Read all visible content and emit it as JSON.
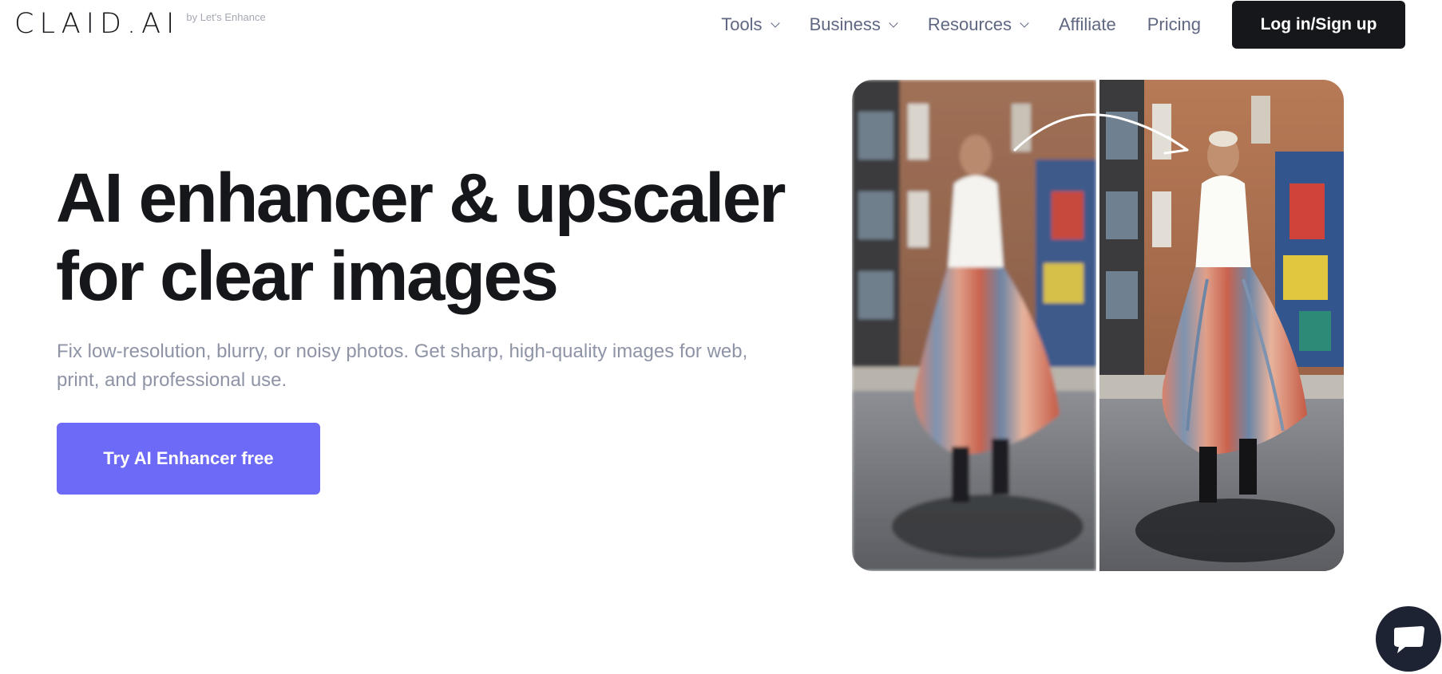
{
  "header": {
    "logo_text": "CLAID.AI",
    "logo_sub": "by Let's Enhance",
    "nav": [
      {
        "label": "Tools",
        "has_dropdown": true
      },
      {
        "label": "Business",
        "has_dropdown": true
      },
      {
        "label": "Resources",
        "has_dropdown": true
      },
      {
        "label": "Affiliate",
        "has_dropdown": false
      },
      {
        "label": "Pricing",
        "has_dropdown": false
      }
    ],
    "login_label": "Log in/Sign up"
  },
  "hero": {
    "title_line1": "AI enhancer & upscaler",
    "title_line2": "for clear images",
    "subtitle": "Fix low-resolution, blurry, or noisy photos. Get sharp, high-quality images for web, print, and professional use.",
    "cta_label": "Try AI Enhancer free"
  },
  "comparison": {
    "left_icon": "blurry-photo",
    "right_icon": "enhanced-photo",
    "arrow_icon": "curved-arrow-icon"
  },
  "chat": {
    "icon": "chat-icon"
  },
  "colors": {
    "text_dark": "#16171b",
    "nav_text": "#5f6782",
    "muted_text": "#8e94a6",
    "cta_bg": "#6c6af6",
    "login_bg": "#16171b",
    "chat_bg": "#1d2333"
  }
}
